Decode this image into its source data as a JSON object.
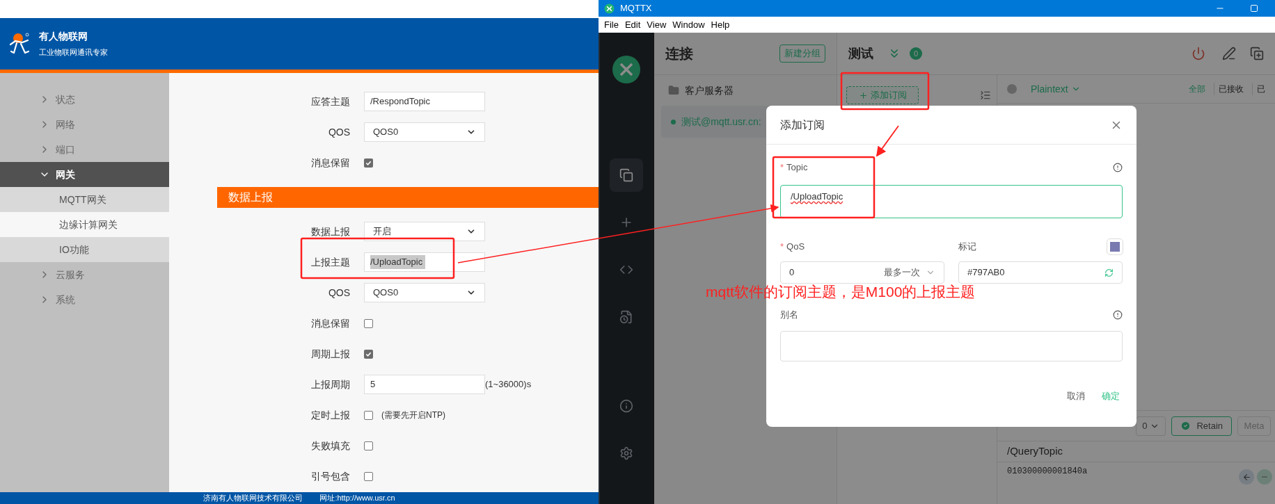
{
  "web_page": {
    "brand": {
      "name": "有人物联网",
      "tagline": "工业物联网通讯专家"
    },
    "sidebar": [
      {
        "label": "状态",
        "expanded": false,
        "selected": false
      },
      {
        "label": "网络",
        "expanded": false,
        "selected": false
      },
      {
        "label": "端口",
        "expanded": false,
        "selected": false
      },
      {
        "label": "网关",
        "expanded": true,
        "selected": true,
        "children": [
          {
            "label": "MQTT网关",
            "selected": false
          },
          {
            "label": "边缘计算网关",
            "selected": true
          },
          {
            "label": "IO功能",
            "selected": false
          }
        ]
      },
      {
        "label": "云服务",
        "expanded": false,
        "selected": false
      },
      {
        "label": "系统",
        "expanded": false,
        "selected": false
      }
    ],
    "fields_top": [
      {
        "kind": "text",
        "label": "应答主题",
        "value": "/RespondTopic",
        "highlighted": false
      },
      {
        "kind": "select",
        "label": "QOS",
        "value": "QOS0"
      },
      {
        "kind": "checkbox",
        "label": "消息保留",
        "checked": true
      }
    ],
    "section_title": "数据上报",
    "fields": [
      {
        "kind": "select",
        "label": "数据上报",
        "value": "开启"
      },
      {
        "kind": "text",
        "label": "上报主题",
        "value": "/UploadTopic",
        "highlighted": true
      },
      {
        "kind": "select",
        "label": "QOS",
        "value": "QOS0"
      },
      {
        "kind": "checkbox",
        "label": "消息保留",
        "checked": false
      },
      {
        "kind": "checkbox",
        "label": "周期上报",
        "checked": true
      },
      {
        "kind": "text",
        "label": "上报周期",
        "value": "5",
        "highlighted": false,
        "suffix": "(1~36000)s"
      },
      {
        "kind": "checkbox",
        "label": "定时上报",
        "checked": false,
        "note": "(需要先开启NTP)"
      },
      {
        "kind": "checkbox",
        "label": "失败填充",
        "checked": false
      },
      {
        "kind": "checkbox",
        "label": "引号包含",
        "checked": false
      }
    ],
    "footer": {
      "company": "济南有人物联网技术有限公司",
      "website": "网址:http://www.usr.cn"
    }
  },
  "mqttx": {
    "window": {
      "title": "MQTTX"
    },
    "menu": [
      "File",
      "Edit",
      "View",
      "Window",
      "Help"
    ],
    "rail": [
      {
        "kind": "connections",
        "selected": true
      },
      {
        "kind": "new",
        "selected": false
      },
      {
        "kind": "script",
        "selected": false
      },
      {
        "kind": "log",
        "selected": false
      },
      {
        "kind": "about",
        "selected": false
      },
      {
        "kind": "settings",
        "selected": false
      }
    ],
    "connections": {
      "title": "连接",
      "new_group_button": "新建分组",
      "groups": [
        {
          "name": "客户服务器"
        }
      ],
      "items": [
        {
          "name": "测试@mqtt.usr.cn:",
          "selected": true,
          "connected": true
        }
      ]
    },
    "header": {
      "name": "测试",
      "count": "0"
    },
    "add_subscription_button": "添加订阅",
    "messages": {
      "format": "Plaintext",
      "filters": [
        {
          "label": "全部",
          "selected": true
        },
        {
          "label": "已接收",
          "selected": false
        },
        {
          "label": "已",
          "selected": false
        }
      ]
    },
    "publish": {
      "qos": "0",
      "retain_button": "Retain",
      "retain": true,
      "meta_button": "Meta",
      "topic": "/QueryTopic",
      "payload": "010300000001840a"
    },
    "dialog": {
      "title": "添加订阅",
      "topic": {
        "mark": "*",
        "label": "Topic",
        "value": "/UploadTopic"
      },
      "qos": {
        "mark": "*",
        "label": "QoS",
        "value": "0",
        "name": "最多一次"
      },
      "tag": {
        "label": "标记",
        "value": "#797AB0",
        "color": "#797ab0"
      },
      "alias": {
        "label": "别名"
      },
      "cancel_button": "取消",
      "confirm_button": "确定"
    }
  },
  "annotation": {
    "note": "mqtt软件的订阅主题，是M100的上报主题"
  }
}
